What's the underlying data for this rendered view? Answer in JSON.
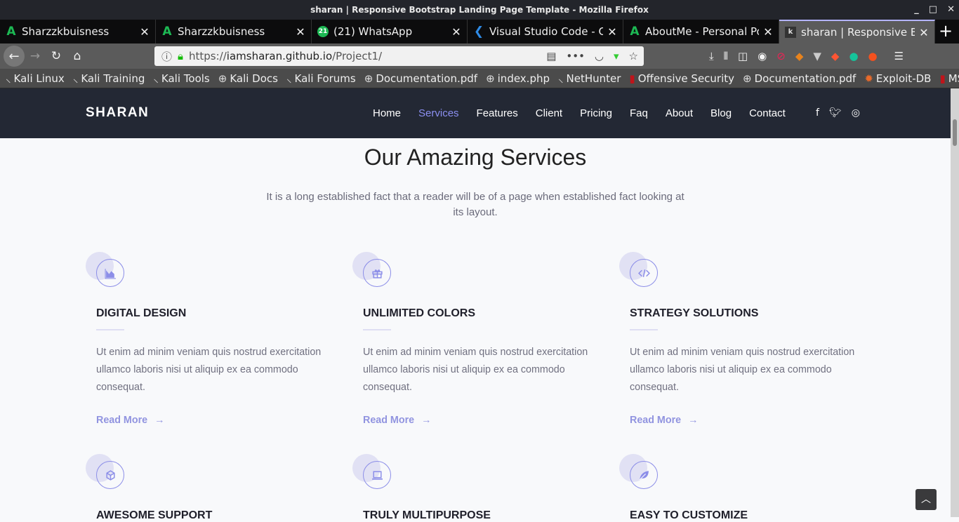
{
  "window": {
    "title": "sharan | Responsive Bootstrap Landing Page Template - Mozilla Firefox"
  },
  "tabs": [
    {
      "label": "Sharzzkbuisness",
      "icon": "A"
    },
    {
      "label": "Sharzzkbuisness",
      "icon": "A"
    },
    {
      "label": "(21) WhatsApp",
      "icon": "21"
    },
    {
      "label": "Visual Studio Code - Code",
      "icon": "vscode"
    },
    {
      "label": "AboutMe - Personal Portfolio",
      "icon": "A"
    },
    {
      "label": "sharan | Responsive Bootstrap",
      "icon": "k"
    }
  ],
  "url": {
    "scheme": "https://",
    "domain": "iamsharan.github.io",
    "path": "/Project1/"
  },
  "bookmarks": [
    "Kali Linux",
    "Kali Training",
    "Kali Tools",
    "Kali Docs",
    "Kali Forums",
    "Documentation.pdf",
    "index.php",
    "NetHunter",
    "Offensive Security",
    "Documentation.pdf",
    "Exploit-DB",
    "MSFU"
  ],
  "site": {
    "brand": "SHARAN",
    "menu": [
      "Home",
      "Services",
      "Features",
      "Client",
      "Pricing",
      "Faq",
      "About",
      "Blog",
      "Contact"
    ],
    "active_menu": "Services",
    "accent": "#8b8ff0"
  },
  "services": {
    "title": "Our Amazing Services",
    "subtitle": "It is a long established fact that a reader will be of a page when established fact looking at its layout.",
    "items": [
      {
        "title": "DIGITAL DESIGN",
        "icon": "chart-area-icon",
        "text": "Ut enim ad minim veniam quis nostrud exercitation ullamco laboris nisi ut aliquip ex ea commodo consequat.",
        "link": "Read More"
      },
      {
        "title": "UNLIMITED COLORS",
        "icon": "gift-icon",
        "text": "Ut enim ad minim veniam quis nostrud exercitation ullamco laboris nisi ut aliquip ex ea commodo consequat.",
        "link": "Read More"
      },
      {
        "title": "STRATEGY SOLUTIONS",
        "icon": "code-icon",
        "text": "Ut enim ad minim veniam quis nostrud exercitation ullamco laboris nisi ut aliquip ex ea commodo consequat.",
        "link": "Read More"
      },
      {
        "title": "AWESOME SUPPORT",
        "icon": "cube-icon"
      },
      {
        "title": "TRULY MULTIPURPOSE",
        "icon": "laptop-icon"
      },
      {
        "title": "EASY TO CUSTOMIZE",
        "icon": "leaf-icon"
      }
    ]
  }
}
